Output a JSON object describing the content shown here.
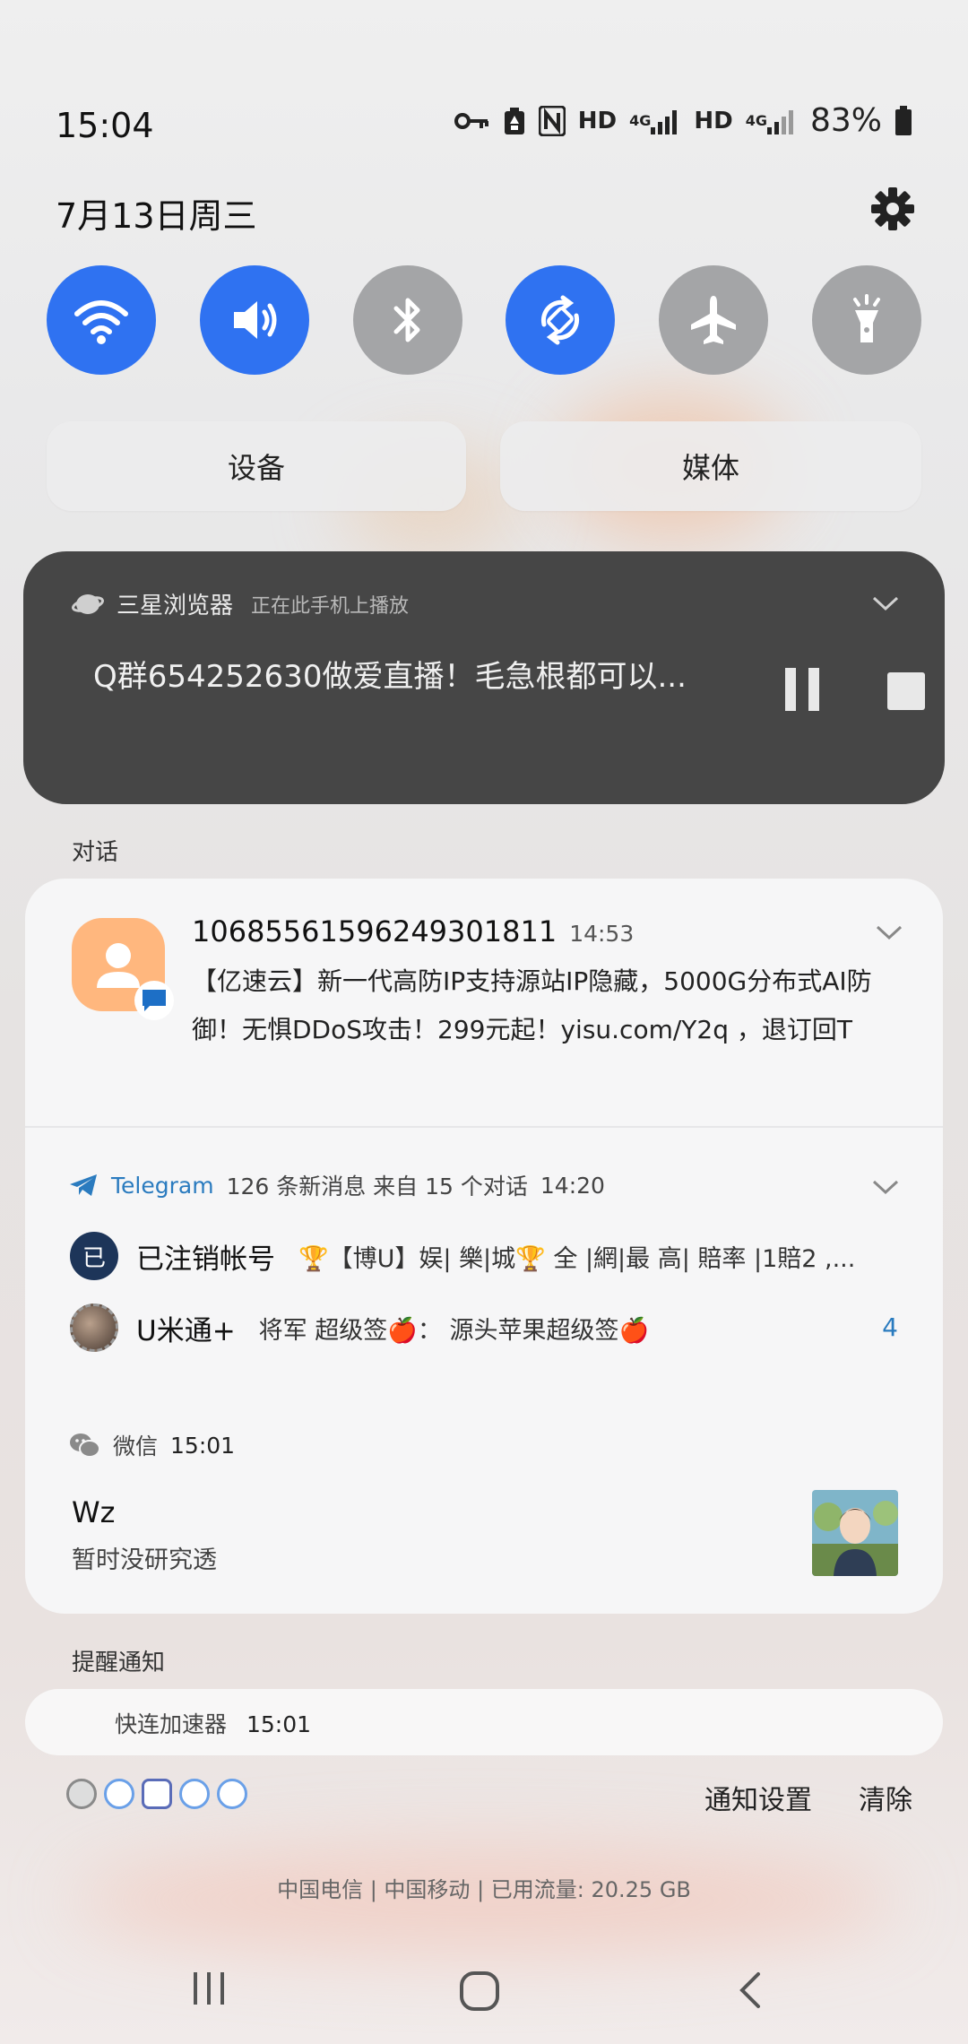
{
  "status_bar": {
    "time": "15:04",
    "hd1": "HD",
    "net1": "4G",
    "hd2": "HD",
    "net2": "4G",
    "battery": "83%"
  },
  "header": {
    "date": "7月13日周三"
  },
  "toggles": [
    {
      "name": "wifi",
      "state": "on"
    },
    {
      "name": "sound",
      "state": "on"
    },
    {
      "name": "bluetooth",
      "state": "off"
    },
    {
      "name": "auto-rotate",
      "state": "on"
    },
    {
      "name": "airplane-mode",
      "state": "off"
    },
    {
      "name": "flashlight",
      "state": "off"
    }
  ],
  "panel_buttons": {
    "devices": "设备",
    "media": "媒体"
  },
  "media_player": {
    "app": "三星浏览器",
    "subtitle": "正在此手机上播放",
    "title": "Q群654252630做爱直播！毛急根都可以..."
  },
  "sections": {
    "conversations": "对话",
    "reminders": "提醒通知"
  },
  "sms": {
    "sender": "10685561596249301811",
    "time": "14:53",
    "body": "【亿速云】新一代高防IP支持源站IP隐藏，5000G分布式AI防御！无惧DDoS攻击！299元起！yisu.com/Y2q ，退订回T"
  },
  "telegram": {
    "app": "Telegram",
    "meta": "126 条新消息 来自 15 个对话",
    "time": "14:20",
    "rows": [
      {
        "avatar": "已",
        "name": "已注销帐号",
        "message": "🏆【博U】娱| 樂|城🏆   全 |網|最 高| 賠率 |1賠2 ,...",
        "count": ""
      },
      {
        "avatar": "",
        "name": "U米通+",
        "message": "将军 超级签🍎：  源头苹果超级签🍎",
        "count": "4"
      }
    ]
  },
  "wechat": {
    "app": "微信",
    "time": "15:01",
    "name": "Wz",
    "message": "暂时没研究透"
  },
  "reminder": {
    "app": "快连加速器",
    "time": "15:01"
  },
  "footer": {
    "notification_settings": "通知设置",
    "clear": "清除",
    "carrier": "中国电信 | 中国移动 | 已用流量: 20.25 GB"
  },
  "colors": {
    "accent": "#2f72f1",
    "toggle_off": "#a4a5a7",
    "media_bg": "#464646",
    "telegram": "#2a7bbf"
  }
}
